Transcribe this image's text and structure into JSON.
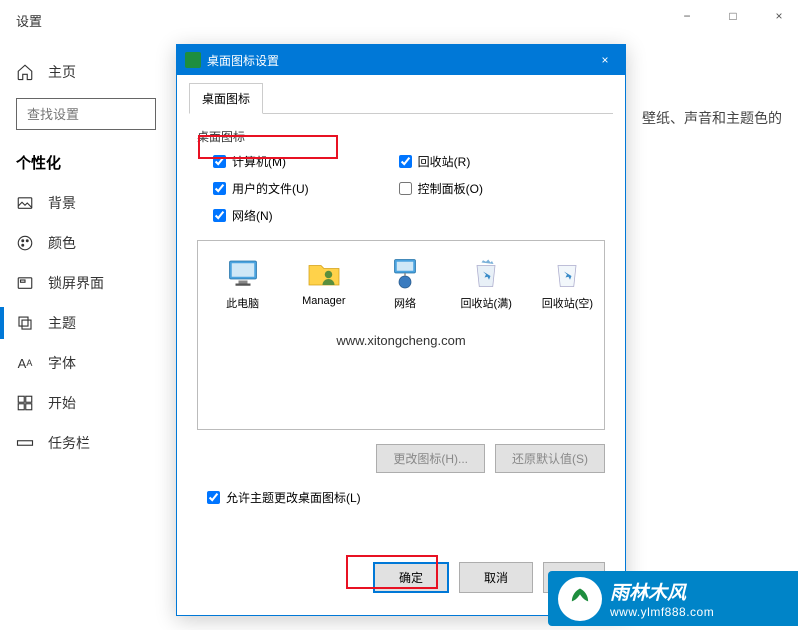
{
  "settings": {
    "title": "设置",
    "titlebar": {
      "min": "−",
      "max": "□",
      "close": "×"
    },
    "home_label": "主页",
    "search_placeholder": "查找设置",
    "section": "个性化",
    "items": [
      {
        "label": "背景"
      },
      {
        "label": "颜色"
      },
      {
        "label": "锁屏界面"
      },
      {
        "label": "主题"
      },
      {
        "label": "字体"
      },
      {
        "label": "开始"
      },
      {
        "label": "任务栏"
      }
    ],
    "content_snippet": "壁纸、声音和主题色的"
  },
  "dialog": {
    "title": "桌面图标设置",
    "close": "×",
    "tab_label": "桌面图标",
    "group_label": "桌面图标",
    "checkboxes": {
      "computer": {
        "label": "计算机(M)",
        "checked": true
      },
      "userfiles": {
        "label": "用户的文件(U)",
        "checked": true
      },
      "network": {
        "label": "网络(N)",
        "checked": true
      },
      "recyclebin": {
        "label": "回收站(R)",
        "checked": true
      },
      "controlpanel": {
        "label": "控制面板(O)",
        "checked": false
      }
    },
    "icons": [
      {
        "name": "此电脑"
      },
      {
        "name": "Manager"
      },
      {
        "name": "网络"
      },
      {
        "name": "回收站(满)"
      },
      {
        "name": "回收站(空)"
      }
    ],
    "watermark": "www.xitongcheng.com",
    "change_icon_btn": "更改图标(H)...",
    "restore_default_btn": "还原默认值(S)",
    "allow_theme": {
      "label": "允许主题更改桌面图标(L)",
      "checked": true
    },
    "ok_btn": "确定",
    "cancel_btn": "取消",
    "apply_btn": "应"
  },
  "logo": {
    "cn": "雨林木风",
    "url": "www.ylmf888.com"
  }
}
